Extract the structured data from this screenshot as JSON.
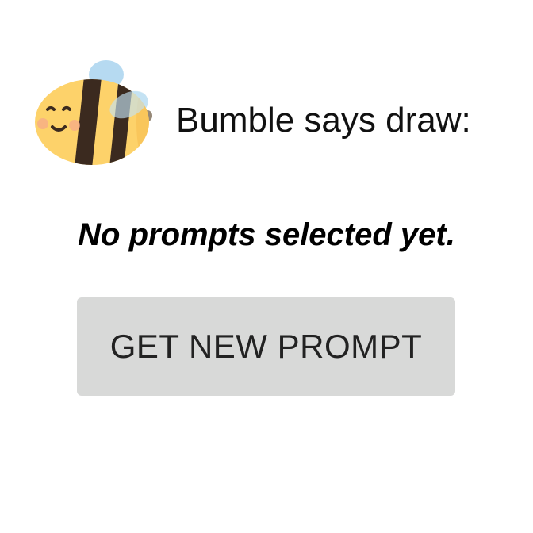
{
  "header": {
    "mascot_icon": "bee-icon",
    "text": "Bumble says draw:"
  },
  "prompt": {
    "status": "No prompts selected yet."
  },
  "actions": {
    "get_prompt_label": "GET NEW PROMPT"
  },
  "colors": {
    "button_bg": "#d8d9d8",
    "bee_yellow": "#fdd26a",
    "bee_stripe": "#3b2a1f",
    "wing_blue": "#a9d4ee"
  }
}
